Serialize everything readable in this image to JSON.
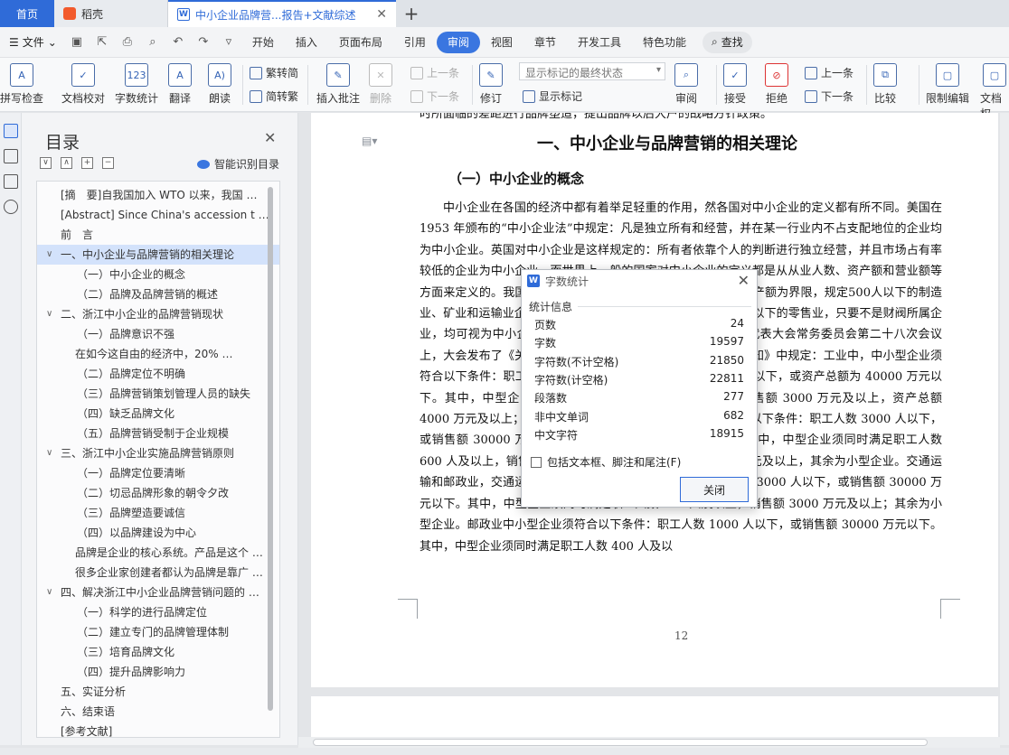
{
  "titlebar": {
    "home_tab": "首页",
    "docer_tab": "稻壳",
    "doc_tab": "中小企业品牌营...报告+文献综述",
    "close_glyph": "✕",
    "new_tab_glyph": "+"
  },
  "menu": {
    "file": "文件",
    "tabs": [
      "开始",
      "插入",
      "页面布局",
      "引用",
      "审阅",
      "视图",
      "章节",
      "开发工具",
      "特色功能"
    ],
    "active_tab": "审阅",
    "search": "查找"
  },
  "ribbon": {
    "spell_check": "拼写检查",
    "doc_proof": "文档校对",
    "word_count": "字数统计",
    "translate": "翻译",
    "read_aloud": "朗读",
    "trad_to_simp": "繁转简",
    "simp_to_trad": "简转繁",
    "insert_comment": "插入批注",
    "delete": "删除",
    "prev": "上一条",
    "next": "下一条",
    "revise": "修订",
    "markup_select": "显示标记的最终状态",
    "show_markup": "显示标记",
    "review": "审阅",
    "accept": "接受",
    "reject": "拒绝",
    "prev2": "上一条",
    "next2": "下一条",
    "compare": "比较",
    "restrict_edit": "限制编辑",
    "doc_rights": "文档权"
  },
  "toc": {
    "title": "目录",
    "smart": "智能识别目录",
    "items": [
      {
        "label": "[摘　要]自我国加入 WTO 以来，我国 …",
        "level": 1,
        "arrow": ""
      },
      {
        "label": "[Abstract] Since China's accession t …",
        "level": 1,
        "arrow": ""
      },
      {
        "label": "前　言",
        "level": 1,
        "arrow": ""
      },
      {
        "label": "一、中小企业与品牌营销的相关理论",
        "level": 1,
        "arrow": "∨",
        "selected": true
      },
      {
        "label": "（一）中小企业的概念",
        "level": 2,
        "arrow": ""
      },
      {
        "label": "（二）品牌及品牌营销的概述",
        "level": 2,
        "arrow": ""
      },
      {
        "label": "二、浙江中小企业的品牌营销现状",
        "level": 1,
        "arrow": "∨"
      },
      {
        "label": "（一）品牌意识不强",
        "level": 2,
        "arrow": ""
      },
      {
        "label": "在如今这自由的经济中，20% …",
        "level": 3,
        "arrow": ""
      },
      {
        "label": "（二）品牌定位不明确",
        "level": 2,
        "arrow": ""
      },
      {
        "label": "（三）品牌营销策划管理人员的缺失",
        "level": 2,
        "arrow": ""
      },
      {
        "label": "（四）缺乏品牌文化",
        "level": 2,
        "arrow": ""
      },
      {
        "label": "（五）品牌营销受制于企业规模",
        "level": 2,
        "arrow": ""
      },
      {
        "label": "三、浙江中小企业实施品牌营销原则",
        "level": 1,
        "arrow": "∨"
      },
      {
        "label": "（一）品牌定位要清晰",
        "level": 2,
        "arrow": ""
      },
      {
        "label": "（二）切忌品牌形象的朝令夕改",
        "level": 2,
        "arrow": ""
      },
      {
        "label": "（三）品牌塑造要诚信",
        "level": 2,
        "arrow": ""
      },
      {
        "label": "（四）以品牌建设为中心",
        "level": 2,
        "arrow": ""
      },
      {
        "label": "品牌是企业的核心系统。产品是这个 …",
        "level": 3,
        "arrow": ""
      },
      {
        "label": "很多企业家创建者都认为品牌是靠广 …",
        "level": 3,
        "arrow": ""
      },
      {
        "label": "四、解决浙江中小企业品牌营销问题的 …",
        "level": 1,
        "arrow": "∨"
      },
      {
        "label": "（一）科学的进行品牌定位",
        "level": 2,
        "arrow": ""
      },
      {
        "label": "（二）建立专门的品牌管理体制",
        "level": 2,
        "arrow": ""
      },
      {
        "label": "（三）培育品牌文化",
        "level": 2,
        "arrow": ""
      },
      {
        "label": "（四）提升品牌影响力",
        "level": 2,
        "arrow": ""
      },
      {
        "label": "五、实证分析",
        "level": 1,
        "arrow": ""
      },
      {
        "label": "六、结束语",
        "level": 1,
        "arrow": ""
      },
      {
        "label": "[参考文献]",
        "level": 1,
        "arrow": ""
      }
    ]
  },
  "document": {
    "top_cut": "时所面临的差距进行品牌塑造，提出品牌以后大户的战略方针政策。",
    "heading": "一、中小企业与品牌营销的相关理论",
    "subheading": "（一）中小企业的概念",
    "paragraph": "中小企业在各国的经济中都有着举足轻重的作用，然各国对中小企业的定义都有所不同。美国在 1953 年颁布的“中小企业法”中规定：凡是独立所有和经营，并在某一行业内不占支配地位的企业均为中小企业。英国对中小企业是这样规定的：所有者依靠个人的判断进行独立经营，并且市场占有率较低的企业为中小企业。而世界上一般的国家对中小企业的定义都是从从业人数、资产额和营业额等方面来定义的。我国是这样定义的：以企业雇佣人数和拥有的资产额为界限，规定500人以下的制造业、矿业和运输业企业，200 人以下的建筑业企业，以及 50 人以下的零售业，只要不是财阀所属企业，均可视为中小企业。我国最新的中小企业标准是全国人民代表大会常务委员会第二十八次会议上，大会发布了《关于印发中小企业标准暂行规定的通知》，《通知》中规定：工业中，中小型企业须符合以下条件：职工人数 2000 人以下，或销售额 30000 万元以下，或资产总额为 40000 万元以下。其中，中型企业须同时满足职工人数 300 人及以上，销售额 3000 万元及以上，资产总额 4000 万元及以上；其余为小型企业。建筑业中小型企业须符合以下条件：职工人数 3000 人以下，或销售额 30000 万元以下，或资产总额 40000 万元以下。其中，中型企业须同时满足职工人数 600 人及以上，销售额 3000 万元及以上，资产总额 4000 万元及以上，其余为小型企业。交通运输和邮政业，交通运输业中小型企业须符合以下条件：职工人数 3000 人以下，或销售额 30000 万元以下。其中，中型企业须同时满足职工人数 500 人及以上，销售额 3000 万元及以上；其余为小型企业。邮政业中小型企业须符合以下条件：职工人数 1000 人以下，或销售额 30000 万元以下。其中，中型企业须同时满足职工人数 400 人及以",
    "page_number": "12"
  },
  "dialog": {
    "title": "字数统计",
    "section": "统计信息",
    "stats": [
      {
        "label": "页数",
        "value": "24"
      },
      {
        "label": "字数",
        "value": "19597"
      },
      {
        "label": "字符数(不计空格)",
        "value": "21850"
      },
      {
        "label": "字符数(计空格)",
        "value": "22811"
      },
      {
        "label": "段落数",
        "value": "277"
      },
      {
        "label": "非中文单词",
        "value": "682"
      },
      {
        "label": "中文字符",
        "value": "18915"
      }
    ],
    "checkbox_label": "包括文本框、脚注和尾注(F)",
    "checkbox_checked": false,
    "close_button": "关闭"
  }
}
